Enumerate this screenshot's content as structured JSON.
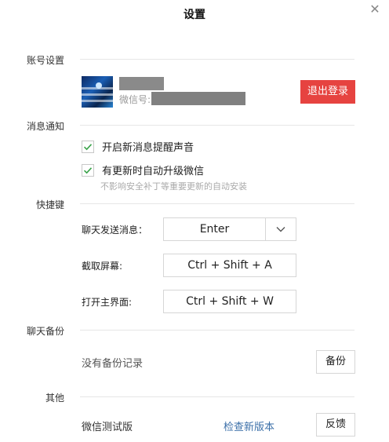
{
  "window": {
    "title": "设置"
  },
  "sections": {
    "account": "账号设置",
    "notify": "消息通知",
    "shortcut": "快捷键",
    "backup": "聊天备份",
    "other": "其他"
  },
  "account": {
    "wechat_id_label": "微信号:",
    "logout_label": "退出登录",
    "accent_color": "#e64340"
  },
  "notify": {
    "sound_label": "开启新消息提醒声音",
    "sound_checked": true,
    "autoupdate_label": "有更新时自动升级微信",
    "autoupdate_checked": true,
    "autoupdate_hint": "不影响安全补丁等重要更新的自动安装"
  },
  "shortcuts": {
    "send_label": "聊天发送消息：",
    "send_value": "Enter",
    "screenshot_label": "截取屏幕:",
    "screenshot_value": "Ctrl + Shift + A",
    "mainwin_label": "打开主界面:",
    "mainwin_value": "Ctrl + Shift + W"
  },
  "backup": {
    "status": "没有备份记录",
    "button_label": "备份"
  },
  "other": {
    "version_label": "微信测试版",
    "check_update_label": "检查新版本",
    "feedback_label": "反馈"
  }
}
